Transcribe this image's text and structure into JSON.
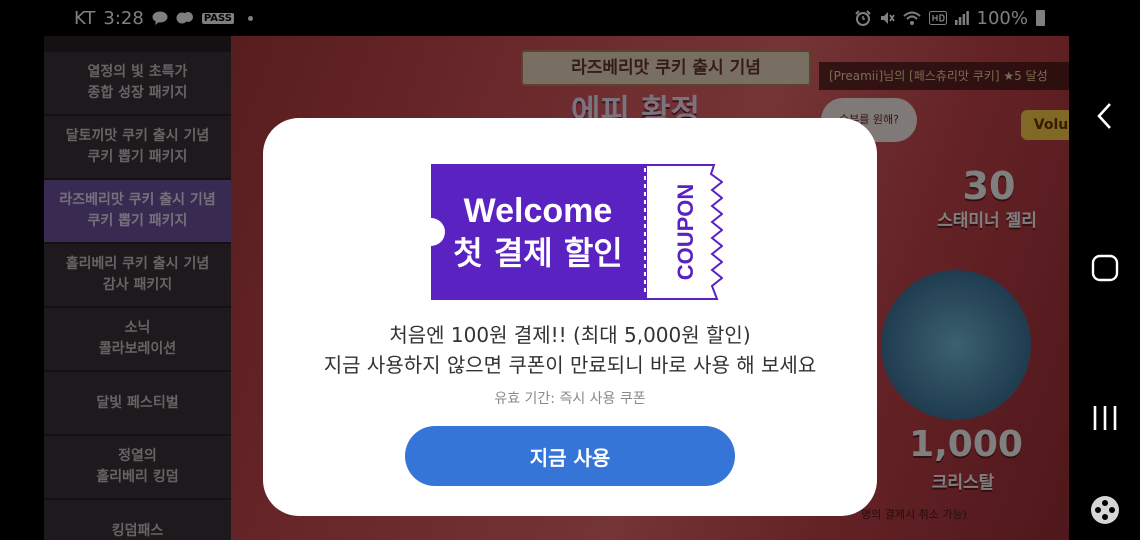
{
  "status_bar": {
    "carrier": "KT",
    "time": "3:28",
    "notification_icons": [
      "talk-icon",
      "chat-bubbles-icon",
      "pass-icon"
    ],
    "pass_label": "PASS",
    "system_icons": [
      "alarm-icon",
      "mute-icon",
      "wifi-icon",
      "hd-icon",
      "signal-icon"
    ],
    "battery": "100%"
  },
  "sidebar": {
    "items": [
      {
        "label": "열정의 빛 초특가\n종합 성장 패키지",
        "active": false
      },
      {
        "label": "달토끼맛 쿠키 출시 기념\n쿠키 뽑기 패키지",
        "active": false
      },
      {
        "label": "라즈베리맛 쿠키 출시 기념\n쿠키 뽑기 패키지",
        "active": true
      },
      {
        "label": "홀리베리 쿠키 출시 기념\n감사 패키지",
        "active": false
      },
      {
        "label": "소닉\n콜라보레이션",
        "active": false
      },
      {
        "label": "달빛 페스티벌",
        "active": false
      },
      {
        "label": "정열의\n홀리베리 킹덤",
        "active": false
      },
      {
        "label": "킹덤패스",
        "active": false
      }
    ]
  },
  "banner": {
    "title": "라즈베리맛 쿠키 출시 기념",
    "headline": "에피 확정",
    "ticker": "[Preamii]님의 [페스츄리맛 쿠키] ★5 달성",
    "bubble": "승부를 원해?",
    "vol_label": "Volu",
    "reward1_amount": "30",
    "reward1_label": "스태미너 젤리",
    "reward2_amount": "1,000",
    "reward2_label": "크리스탈",
    "footnote": "명의 결제시 취소 가능)"
  },
  "dialog": {
    "coupon": {
      "line1": "Welcome",
      "line2": "첫 결제 할인",
      "stub": "COUPON",
      "color": "#5b22c2"
    },
    "message_line1": "처음엔 100원 결제!! (최대 5,000원 할인)",
    "message_line2": "지금 사용하지 않으면 쿠폰이 만료되니 바로 사용 해 보세요",
    "validity": "유효 기간: 즉시 사용 쿠폰",
    "button_label": "지금 사용",
    "button_color": "#3575d8"
  },
  "nav_bar": {
    "buttons": [
      "back-icon",
      "home-icon",
      "recents-icon",
      "game-controller-icon"
    ]
  }
}
